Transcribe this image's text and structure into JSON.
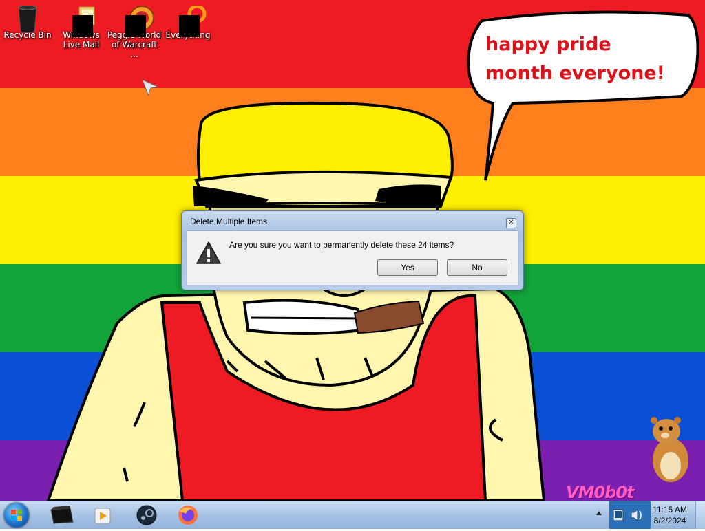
{
  "desktop_icons": [
    {
      "label": "Recycle Bin",
      "icon": "recycle-bin-icon"
    },
    {
      "label": "Windows Live Mail",
      "icon": "mail-icon"
    },
    {
      "label": "Peggle World of Warcraft ...",
      "icon": "peggle-icon"
    },
    {
      "label": "Everything",
      "icon": "search-app-icon"
    }
  ],
  "wallpaper": {
    "speech_text": "happy pride month everyone!",
    "watermark": "VM0b0t",
    "stripe_colors": [
      "#ed1c24",
      "#ff7f1e",
      "#ffef00",
      "#12a33a",
      "#0a50d6",
      "#7a1fb0"
    ]
  },
  "dialog": {
    "title": "Delete Multiple Items",
    "message": "Are you sure you want to permanently delete these 24 items?",
    "yes_label": "Yes",
    "no_label": "No",
    "icon": "warning-icon"
  },
  "taskbar": {
    "pinned": [
      "terminal-icon",
      "media-player-icon",
      "steam-icon",
      "firefox-icon"
    ],
    "clock_time": "11:15 AM",
    "clock_date": "8/2/2024"
  }
}
